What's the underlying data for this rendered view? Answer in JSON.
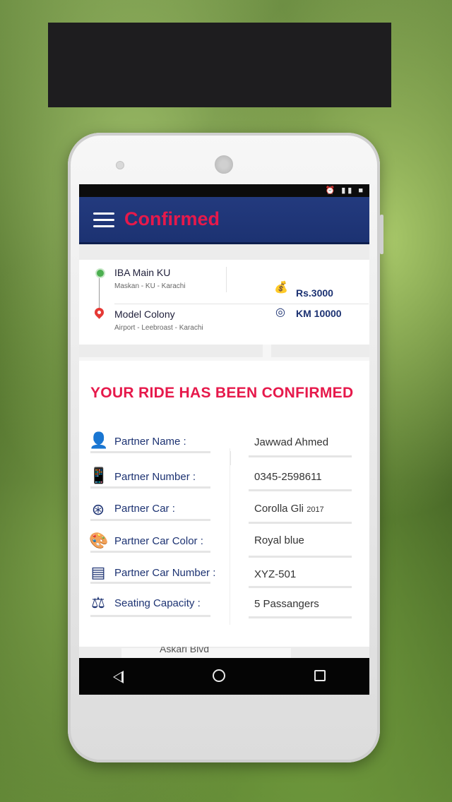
{
  "app": {
    "title": "Confirmed"
  },
  "route": {
    "pickup": {
      "title": "IBA Main KU",
      "subtitle": "Maskan - KU - Karachi"
    },
    "dropoff": {
      "title": "Model Colony",
      "subtitle": "Airport - Leebroast - Karachi"
    },
    "fare": "Rs.3000",
    "distance": "KM 10000"
  },
  "map": {
    "street_label": "Askari Blvd"
  },
  "confirmation": {
    "heading": "YOUR RIDE HAS BEEN CONFIRMED",
    "rows": [
      {
        "label": "Partner Name :",
        "value": "Jawwad Ahmed",
        "icon": "person-icon"
      },
      {
        "label": "Partner Number :",
        "value": "0345-2598611",
        "icon": "phone-icon"
      },
      {
        "label": "Partner Car :",
        "value": "Corolla Gli",
        "value_suffix": "2017",
        "icon": "steering-wheel-icon"
      },
      {
        "label": "Partner Car Color :",
        "value": "Royal blue",
        "icon": "spray-paint-icon"
      },
      {
        "label": "Partner Car Number :",
        "value": "XYZ-501",
        "icon": "license-plate-icon"
      },
      {
        "label": "Seating Capacity :",
        "value": "5 Passangers",
        "icon": "weight-icon"
      }
    ]
  },
  "colors": {
    "accent": "#e6194b",
    "primary": "#1c3272"
  }
}
